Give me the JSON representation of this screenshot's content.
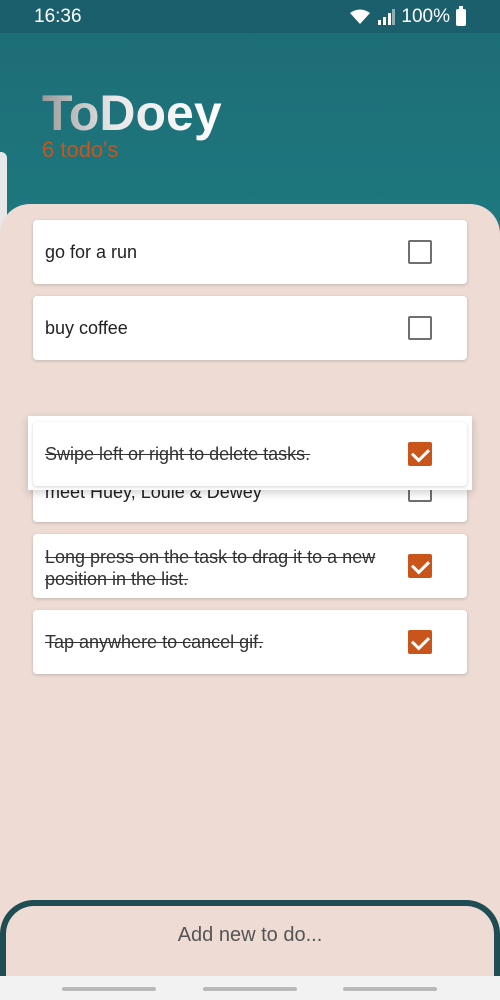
{
  "status_bar": {
    "time": "16:36",
    "battery": "100%"
  },
  "app": {
    "title": "ToDoey",
    "subtitle": "6 todo's"
  },
  "tasks": [
    {
      "text": "go for a run",
      "done": false
    },
    {
      "text": "buy coffee",
      "done": false
    },
    {
      "text": "meet Huey, Louie & Dewey",
      "done": false
    },
    {
      "text": "Long press on the task to drag it to a new position in the list.",
      "done": true
    },
    {
      "text": "Tap anywhere to cancel gif.",
      "done": true
    }
  ],
  "dragging_task": {
    "text": "Swipe left or right to delete tasks.",
    "done": true
  },
  "bottom": {
    "add_label": "Add new to do..."
  },
  "colors": {
    "accent": "#c9551a",
    "header": "#1e6f78",
    "sheet": "#eddbd4"
  }
}
